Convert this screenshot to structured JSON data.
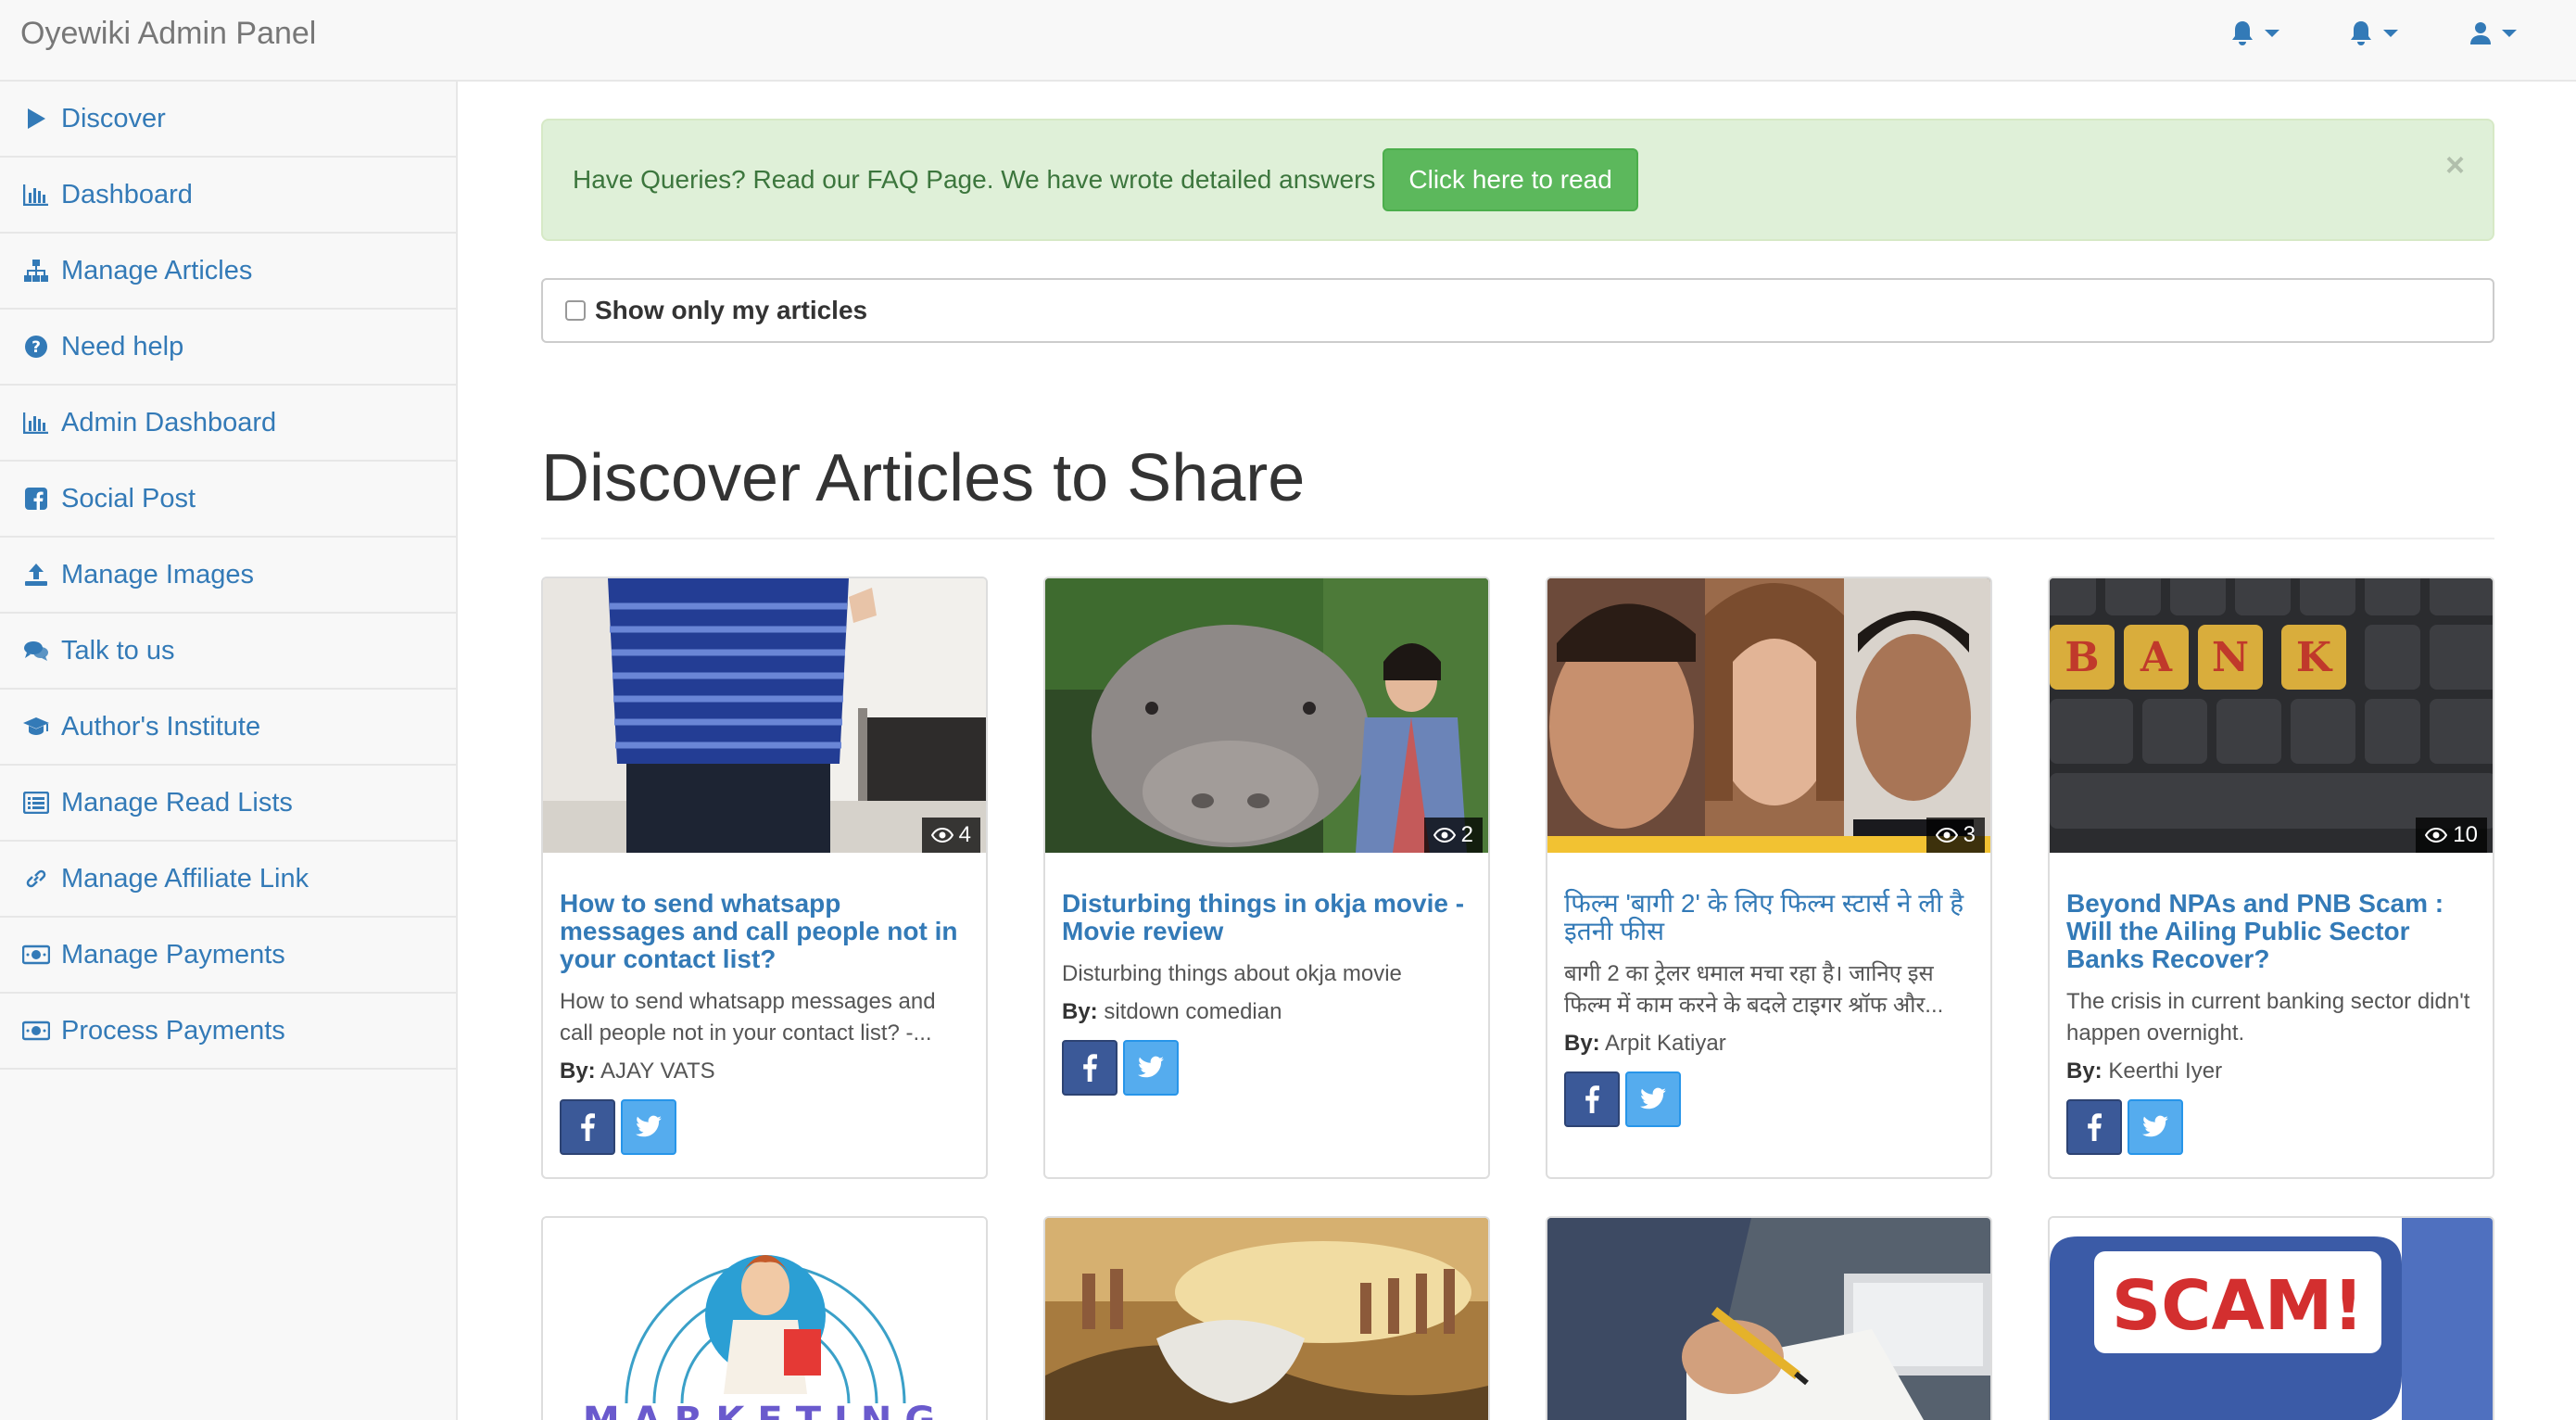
{
  "app": {
    "brand": "Oyewiki Admin Panel"
  },
  "navbar": {
    "items": [
      {
        "icon": "bell-icon"
      },
      {
        "icon": "bell-icon"
      },
      {
        "icon": "user-icon"
      }
    ]
  },
  "sidebar": {
    "items": [
      {
        "label": "Discover",
        "icon": "play-icon"
      },
      {
        "label": "Dashboard",
        "icon": "bar-chart-icon"
      },
      {
        "label": "Manage Articles",
        "icon": "sitemap-icon"
      },
      {
        "label": "Need help",
        "icon": "question-circle-icon"
      },
      {
        "label": "Admin Dashboard",
        "icon": "bar-chart-icon"
      },
      {
        "label": "Social Post",
        "icon": "facebook-square-icon"
      },
      {
        "label": "Manage Images",
        "icon": "upload-icon"
      },
      {
        "label": "Talk to us",
        "icon": "comments-icon"
      },
      {
        "label": "Author's Institute",
        "icon": "graduation-cap-icon"
      },
      {
        "label": "Manage Read Lists",
        "icon": "list-alt-icon"
      },
      {
        "label": "Manage Affiliate Link",
        "icon": "link-icon"
      },
      {
        "label": "Manage Payments",
        "icon": "money-icon"
      },
      {
        "label": "Process Payments",
        "icon": "money-icon"
      }
    ]
  },
  "alert": {
    "message": "Have Queries? Read our FAQ Page. We have wrote detailed answers",
    "button_label": "Click here to read",
    "close_label": "×"
  },
  "filter": {
    "label": "Show only my articles"
  },
  "page": {
    "title": "Discover Articles to Share"
  },
  "articles": [
    {
      "title": "How to send whatsapp messages and call people not in your contact list?",
      "description": "How to send whatsapp messages and call people not in your contact list? -...",
      "by_label": "By:",
      "author": "AJAY VATS",
      "views": "4"
    },
    {
      "title": "Disturbing things in okja movie - Movie review",
      "description": "Disturbing things about okja movie",
      "by_label": "By:",
      "author": "sitdown comedian",
      "views": "2"
    },
    {
      "title": "फिल्म 'बागी 2' के लिए फिल्म स्टार्स ने ली है इतनी फीस",
      "description": "बागी 2 का ट्रेलर धमाल मचा रहा है। जानिए इस फिल्म में काम करने के बदले टाइगर श्रॉफ और...",
      "by_label": "By:",
      "author": "Arpit Katiyar",
      "views": "3"
    },
    {
      "title": "Beyond NPAs and PNB Scam : Will the Ailing Public Sector Banks Recover?",
      "description": "The crisis in current banking sector didn't happen overnight.",
      "by_label": "By:",
      "author": "Keerthi Iyer",
      "views": "10"
    }
  ],
  "thumb_text": {
    "bank_keys": [
      "B",
      "A",
      "N",
      "K"
    ],
    "marketing": "MARKETING",
    "scam": "SCAM!"
  },
  "colors": {
    "link": "#337ab7",
    "success_bg": "#dff0d8",
    "success_btn": "#5cb85c",
    "facebook": "#3b5998",
    "twitter": "#55acee"
  }
}
